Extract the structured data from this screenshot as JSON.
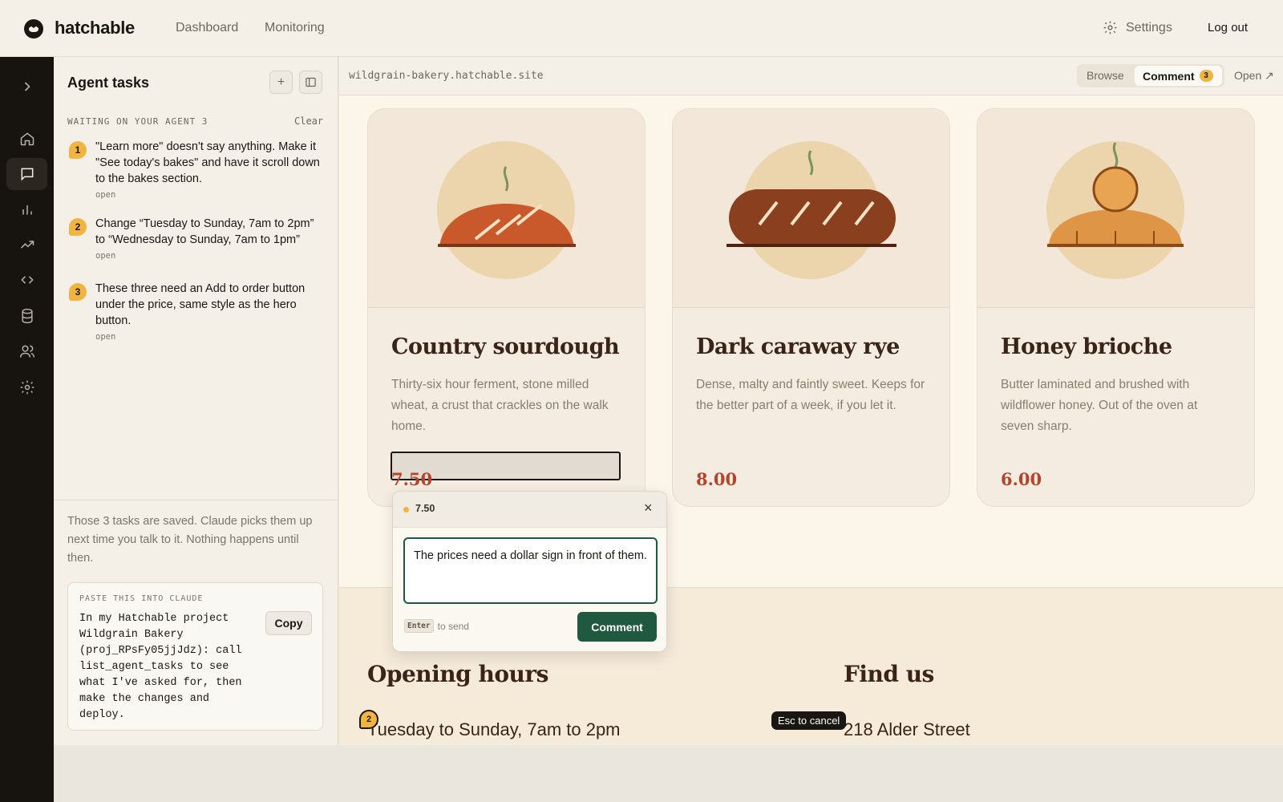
{
  "app": {
    "brand": "hatchable",
    "nav": [
      "Dashboard",
      "Monitoring"
    ],
    "settings_label": "Settings",
    "logout_label": "Log out"
  },
  "rail": {
    "items": [
      "chevron-right-icon",
      "home-icon",
      "chat-icon",
      "bar-chart-icon",
      "trending-icon",
      "code-icon",
      "database-icon",
      "users-icon",
      "gear-icon"
    ],
    "active": "chat-icon"
  },
  "panel": {
    "title": "Agent tasks",
    "waiting_label": "WAITING ON YOUR AGENT 3",
    "clear_label": "Clear",
    "tasks": [
      {
        "num": "1",
        "text": "\"Learn more\" doesn't say anything. Make it \"See today's bakes\" and have it scroll down to the bakes section.",
        "status": "open"
      },
      {
        "num": "2",
        "text": "Change “Tuesday to Sunday, 7am to 2pm” to “Wednesday to Sunday, 7am to 1pm”",
        "status": "open"
      },
      {
        "num": "3",
        "text": "These three need an Add to order button under the price, same style as the hero button.",
        "status": "open"
      }
    ],
    "saved_note": "Those 3 tasks are saved. Claude picks them up next time you talk to it. Nothing happens until then.",
    "paste_label": "PASTE THIS INTO CLAUDE",
    "paste_text": "In my Hatchable project\nWildgrain Bakery\n(proj_RPsFy05jjJdz): call\nlist_agent_tasks to see\nwhat I've asked for, then\nmake the changes and\ndeploy.",
    "copy_label": "Copy"
  },
  "preview": {
    "url": "wildgrain-bakery.hatchable.site",
    "browse_label": "Browse",
    "comment_label": "Comment",
    "comment_count": "3",
    "open_label": "Open ↗"
  },
  "site": {
    "cards": [
      {
        "name": "Country sourdough",
        "desc": "Thirty-six hour ferment, stone milled wheat, a crust that crackles on the walk home.",
        "price": "7.50"
      },
      {
        "name": "Dark caraway rye",
        "desc": "Dense, malty and faintly sweet. Keeps for the better part of a week, if you let it.",
        "price": "8.00"
      },
      {
        "name": "Honey brioche",
        "desc": "Butter laminated and brushed with wildflower honey. Out of the oven at seven sharp.",
        "price": "6.00"
      }
    ],
    "hours_title": "Opening hours",
    "hours_line": "Tuesday to Sunday, 7am to 2pm",
    "find_title": "Find us",
    "find_line": "218 Alder Street",
    "pin_2": "2"
  },
  "popover": {
    "target": "7.50",
    "text": "The prices need a dollar sign in front of them.",
    "hint_key": "Enter",
    "hint_text": "to send",
    "send_label": "Comment"
  },
  "esc_hint": "Esc to cancel",
  "colors": {
    "accent_green": "#1f5a40",
    "badge_yellow": "#f2b441",
    "price_red": "#b4452a"
  }
}
